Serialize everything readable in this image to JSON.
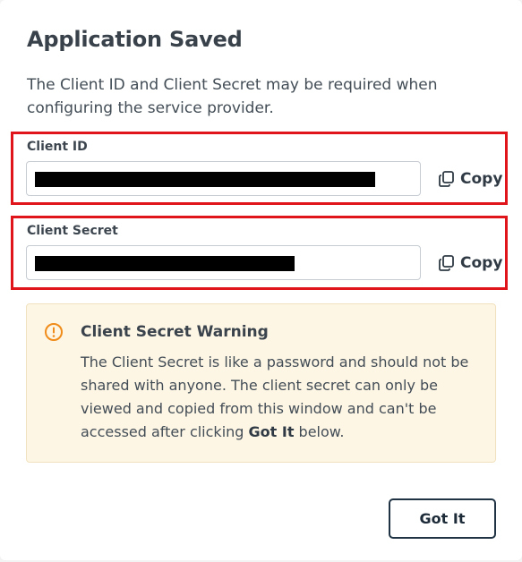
{
  "dialog": {
    "title": "Application Saved",
    "description": "The Client ID and Client Secret may be required when configuring the service provider."
  },
  "client_id": {
    "label": "Client ID",
    "value": "",
    "copy_label": "Copy"
  },
  "client_secret": {
    "label": "Client Secret",
    "value": "",
    "copy_label": "Copy"
  },
  "warning": {
    "title": "Client Secret Warning",
    "body_prefix": "The Client Secret is like a password and should not be shared with anyone. The client secret can only be viewed and copied from this window and can't be accessed after clicking ",
    "body_emphasis": "Got It",
    "body_suffix": " below.",
    "accent_color": "#f08c1a",
    "background_color": "#fef6e5"
  },
  "footer": {
    "got_it_label": "Got It"
  },
  "icons": {
    "copy": "copy-icon",
    "warning": "warning-circle-icon"
  },
  "colors": {
    "highlight_border": "#e0141b",
    "primary_button_border": "#1f3345"
  }
}
